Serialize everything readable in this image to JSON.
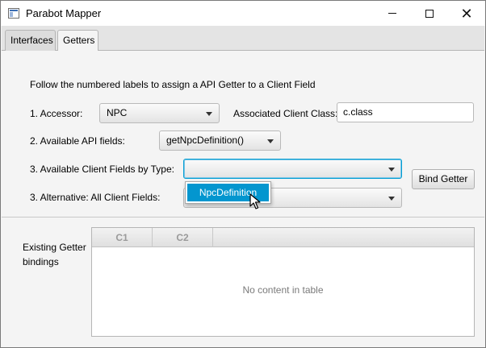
{
  "window": {
    "title": "Parabot Mapper",
    "icon": "app-window-icon",
    "controls": {
      "minimize": "minimize-icon",
      "maximize": "maximize-icon",
      "close": "close-icon"
    }
  },
  "tabs": [
    {
      "label": "Interfaces",
      "selected": false
    },
    {
      "label": "Getters",
      "selected": true
    }
  ],
  "getters": {
    "instructions": "Follow the numbered labels to assign a API Getter to a Client Field",
    "accessor_label": "1. Accessor:",
    "accessor_value": "NPC",
    "assoc_class_label": "Associated Client Class:",
    "assoc_class_value": "c.class",
    "api_fields_label": "2. Available API fields:",
    "api_fields_value": "getNpcDefinition()",
    "client_fields_label": "3. Available Client Fields by Type:",
    "client_fields_value": "",
    "client_fields_popup_option": "NpcDefinition",
    "alt_fields_label": "3. Alternative: All Client Fields:",
    "alt_fields_value": "",
    "bind_button": "Bind Getter"
  },
  "bindings": {
    "label_line1": "Existing Getter",
    "label_line2": "bindings",
    "columns": [
      "C1",
      "C2"
    ],
    "empty_text": "No content in table",
    "rows": []
  },
  "colors": {
    "accent": "#0396cf",
    "focus_border": "#039ed3"
  }
}
